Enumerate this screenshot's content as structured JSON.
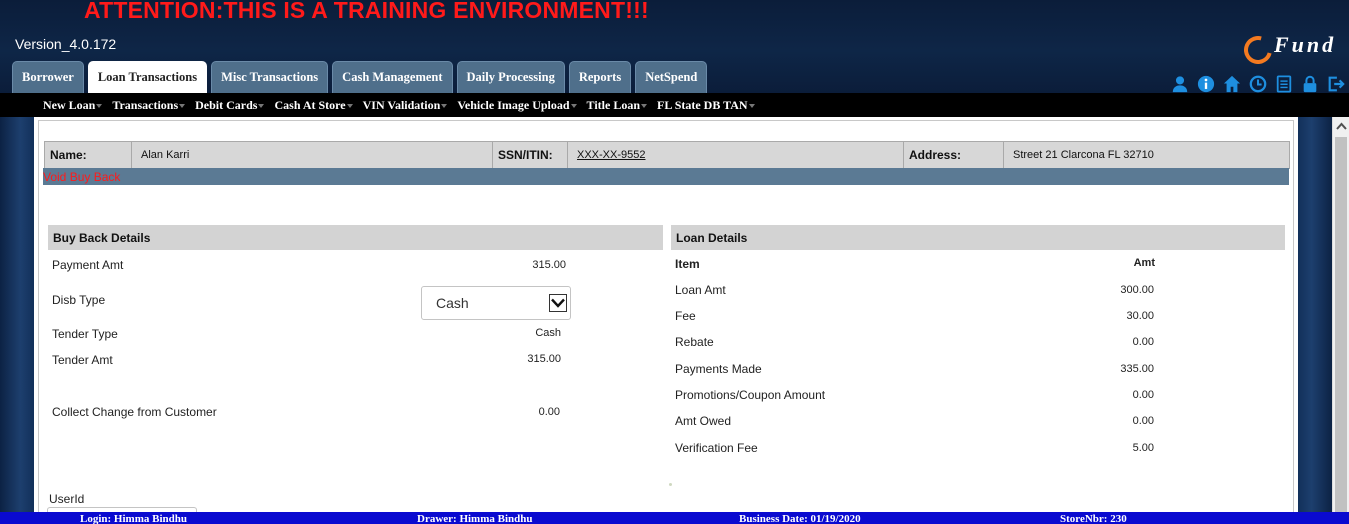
{
  "header": {
    "training_banner": "ATTENTION:THIS IS A TRAINING ENVIRONMENT!!!",
    "version": "Version_4.0.172",
    "logo_text": "Fund",
    "tabs": [
      {
        "label": "Borrower"
      },
      {
        "label": "Loan Transactions"
      },
      {
        "label": "Misc Transactions"
      },
      {
        "label": "Cash Management"
      },
      {
        "label": "Daily Processing"
      },
      {
        "label": "Reports"
      },
      {
        "label": "NetSpend"
      }
    ],
    "active_tab": "Loan Transactions",
    "icons": [
      "user-icon",
      "info-icon",
      "home-icon",
      "clock-icon",
      "document-icon",
      "lock-icon",
      "logout-icon"
    ],
    "icon_color": "#1e8fe0"
  },
  "submenu": {
    "items": [
      {
        "label": "New Loan"
      },
      {
        "label": "Transactions"
      },
      {
        "label": "Debit Cards"
      },
      {
        "label": "Cash At Store"
      },
      {
        "label": "VIN Validation"
      },
      {
        "label": "Vehicle Image Upload"
      },
      {
        "label": "Title Loan"
      },
      {
        "label": "FL State DB TAN"
      }
    ]
  },
  "customer": {
    "name_label": "Name:",
    "name": "Alan Karri",
    "ssn_label": "SSN/ITIN:",
    "ssn": "XXX-XX-9552",
    "address_label": "Address:",
    "address": "Street 21  Clarcona  FL  32710"
  },
  "action_title": "Void Buy Back",
  "buy_back": {
    "title": "Buy Back Details",
    "payment_amt_label": "Payment Amt",
    "payment_amt": "315.00",
    "disb_type_label": "Disb Type",
    "disb_type_selected": "Cash",
    "tender_type_label": "Tender Type",
    "tender_type": "Cash",
    "tender_amt_label": "Tender Amt",
    "tender_amt": "315.00",
    "collect_change_label": "Collect Change from Customer",
    "collect_change": "0.00"
  },
  "loan_details": {
    "title": "Loan Details",
    "item_header": "Item",
    "amt_header": "Amt",
    "rows": [
      {
        "label": "Loan Amt",
        "value": "300.00"
      },
      {
        "label": "Fee",
        "value": "30.00"
      },
      {
        "label": "Rebate",
        "value": "0.00"
      },
      {
        "label": "Payments Made",
        "value": "335.00"
      },
      {
        "label": "Promotions/Coupon Amount",
        "value": "0.00"
      },
      {
        "label": "Amt Owed",
        "value": "0.00"
      },
      {
        "label": "Verification Fee",
        "value": "5.00"
      }
    ]
  },
  "userid_label": "UserId",
  "footer": {
    "login": "Login: Himma Bindhu",
    "drawer": "Drawer: Himma Bindhu",
    "business_date": "Business Date: 01/19/2020",
    "store": "StoreNbr: 230"
  },
  "colors": {
    "banner": "#ff1a1a",
    "tab_bg": "#4f6f8b",
    "footer_bg": "#0a0ad0",
    "action_bar": "#5b7a94",
    "logo_accent": "#f47a20"
  }
}
